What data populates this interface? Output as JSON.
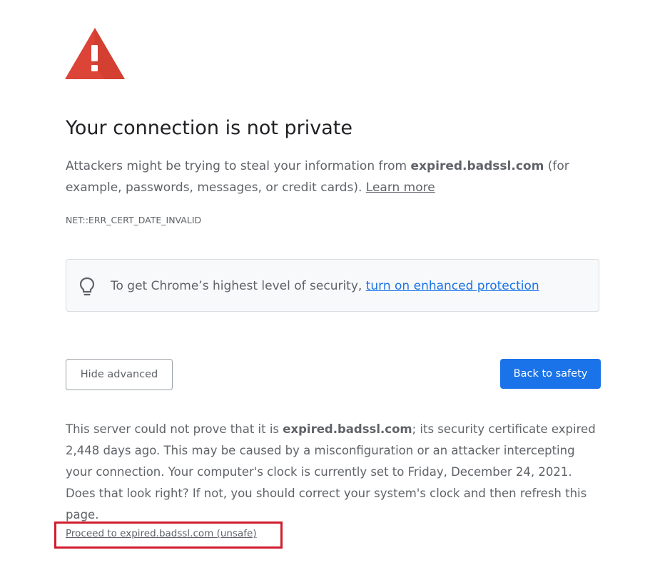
{
  "colors": {
    "warning_red": "#db4437",
    "link_blue": "#1a73e8",
    "button_blue": "#1a73e8",
    "highlight_red": "#d11d2f",
    "text_gray": "#5f6368",
    "title_dark": "#202124",
    "box_background": "#f8f9fa"
  },
  "icons": {
    "warning": "warning-triangle-icon",
    "bulb": "lightbulb-icon"
  },
  "page": {
    "title": "Your connection is not private",
    "intro_before": "Attackers might be trying to steal your information from ",
    "intro_domain": "expired.badssl.com",
    "intro_after": " (for example, passwords, messages, or credit cards). ",
    "learn_more": "Learn more",
    "error_code": "NET::ERR_CERT_DATE_INVALID"
  },
  "enhanced": {
    "text": "To get Chrome’s highest level of security, ",
    "link": "turn on enhanced protection"
  },
  "buttons": {
    "hide_advanced": "Hide advanced",
    "back_to_safety": "Back to safety"
  },
  "advanced": {
    "before": "This server could not prove that it is ",
    "domain": "expired.badssl.com",
    "after": "; its security certificate expired 2,448 days ago. This may be caused by a misconfiguration or an attacker intercepting your connection. Your computer's clock is currently set to Friday, December 24, 2021. Does that look right? If not, you should correct your system's clock and then refresh this page.",
    "proceed_link": "Proceed to expired.badssl.com (unsafe)"
  }
}
